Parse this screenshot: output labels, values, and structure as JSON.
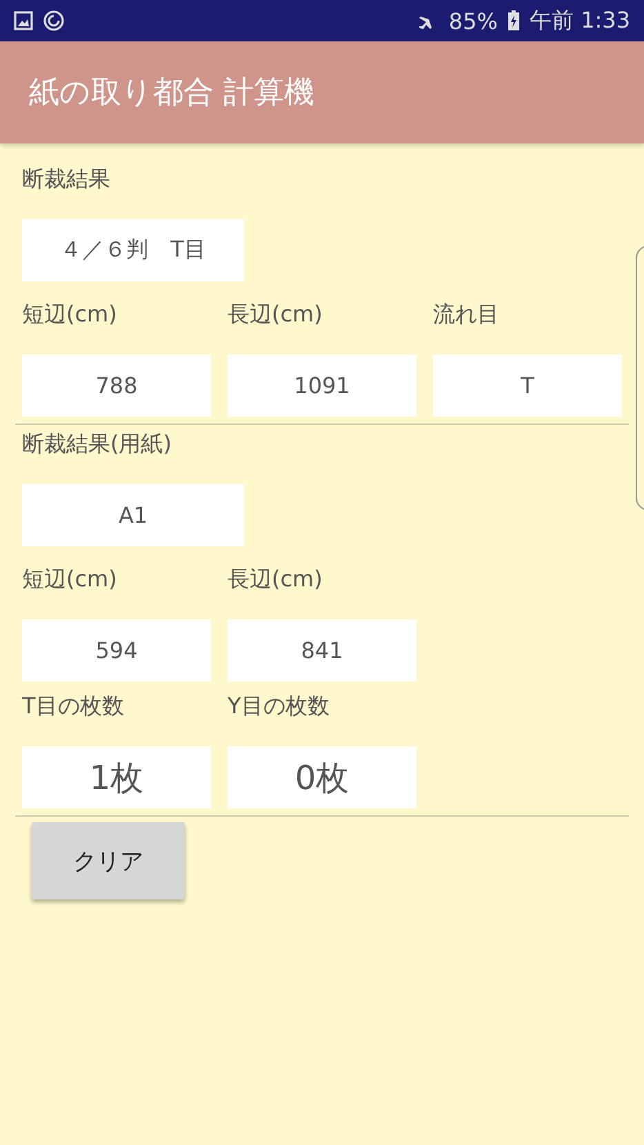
{
  "status_bar": {
    "battery": "85%",
    "time": "午前 1:33"
  },
  "app_bar": {
    "title": "紙の取り都合 計算機"
  },
  "rows": [
    {
      "kind": "labels",
      "items": [
        "断裁結果"
      ]
    },
    {
      "kind": "wide_field",
      "items": [
        "４／６判　T目"
      ]
    },
    {
      "kind": "labels",
      "items": [
        "短辺(cm)",
        "長辺(cm)",
        "流れ目"
      ]
    },
    {
      "kind": "fields",
      "items": [
        "788",
        "1091",
        "T"
      ]
    },
    {
      "kind": "divider",
      "items": []
    },
    {
      "kind": "labels",
      "items": [
        "断裁結果(用紙)"
      ]
    },
    {
      "kind": "wide_field",
      "items": [
        "A1"
      ]
    },
    {
      "kind": "labels",
      "items": [
        "短辺(cm)",
        "長辺(cm)"
      ]
    },
    {
      "kind": "fields",
      "items": [
        "594",
        "841"
      ]
    },
    {
      "kind": "labels",
      "items": [
        "T目の枚数",
        "Y目の枚数"
      ]
    },
    {
      "kind": "count_fields",
      "items": [
        "1枚",
        "0枚"
      ]
    },
    {
      "kind": "divider",
      "items": []
    },
    {
      "kind": "button",
      "items": [
        "クリア"
      ]
    }
  ]
}
